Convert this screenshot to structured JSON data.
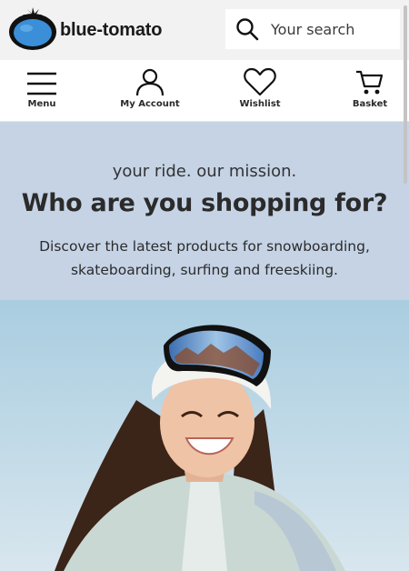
{
  "header": {
    "logo_text": "blue-tomato",
    "search": {
      "placeholder": "Your search",
      "icon": "search-icon"
    }
  },
  "nav": {
    "items": [
      {
        "label": "Menu",
        "icon": "hamburger-menu-icon"
      },
      {
        "label": "My Account",
        "icon": "user-icon"
      },
      {
        "label": "Wishlist",
        "icon": "heart-icon"
      },
      {
        "label": "Basket",
        "icon": "shopping-cart-icon"
      }
    ]
  },
  "hero": {
    "tagline": "your ride. our mission.",
    "headline": "Who are you shopping for?",
    "description": "Discover the latest products for snowboarding, skateboarding, surfing and freeskiing.",
    "background_color": "#c5d3e5"
  },
  "colors": {
    "logo_blue": "#3a8fd8",
    "text_dark": "#2b2b2b",
    "header_bg": "#f2f2f2"
  }
}
